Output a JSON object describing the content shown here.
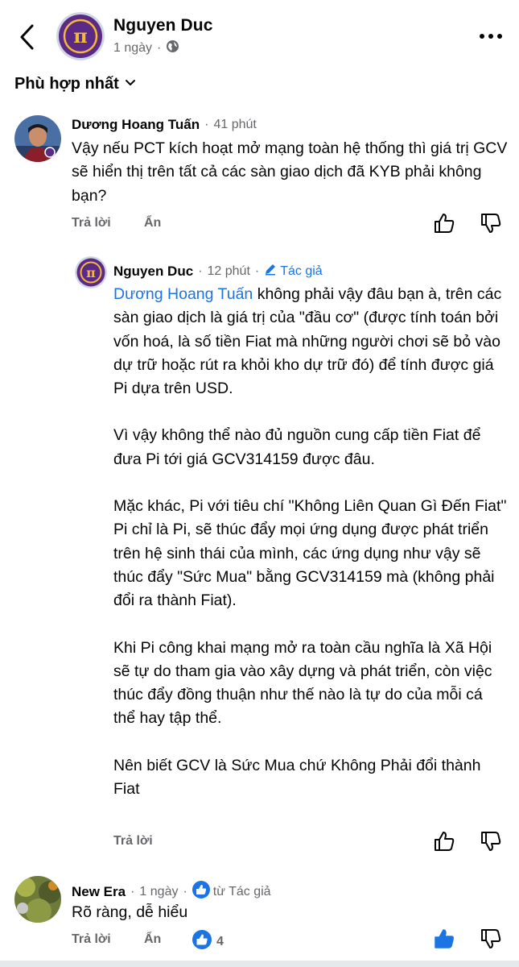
{
  "header": {
    "name": "Nguyen Duc",
    "time": "1 ngày",
    "separator": "·"
  },
  "sort": {
    "label": "Phù hợp nhất"
  },
  "comments": [
    {
      "author": "Dương Hoang Tuấn",
      "time": "41 phút",
      "text": "Vậy nếu PCT kích hoạt mở mạng toàn hệ thống thì giá trị GCV sẽ hiển thị trên tất cả các sàn giao dịch đã KYB phải không bạn?",
      "reply_label": "Trả lời",
      "hide_label": "Ẩn"
    },
    {
      "author": "Nguyen Duc",
      "time": "12 phút",
      "author_tag": "Tác giả",
      "mention": "Dương Hoang Tuấn",
      "paragraphs": [
        " không phải vậy đâu bạn à, trên các sàn giao dịch là giá trị của \"đầu cơ\" (được tính toán bởi vốn hoá, là số tiền Fiat mà những người chơi sẽ bỏ vào dự trữ hoặc rút ra khỏi kho dự trữ đó) để tính được giá Pi dựa trên USD.",
        "Vì vậy không thể nào đủ nguồn cung cấp tiền Fiat để đưa Pi tới giá GCV314159 được đâu.",
        "Mặc khác, Pi với tiêu chí \"Không Liên Quan Gì Đến Fiat\" Pi chỉ là Pi, sẽ thúc đẩy mọi ứng dụng được phát triển trên hệ sinh thái của mình, các ứng dụng như vậy sẽ thúc đẩy \"Sức Mua\" bằng GCV314159 mà (không phải đổi ra thành Fiat).",
        "Khi Pi công khai mạng mở ra toàn cầu nghĩa là Xã Hội sẽ tự do tham gia vào xây dựng và phát triển, còn việc thúc đẩy đồng thuận như thế nào là tự do của mỗi cá thể hay tập thể.",
        "Nên biết GCV là Sức Mua chứ Không Phải đổi thành Fiat"
      ],
      "reply_label": "Trả lời"
    },
    {
      "author": "New Era",
      "time": "1 ngày",
      "liked_by": "từ Tác giả",
      "text": "Rõ ràng, dễ hiểu",
      "reply_label": "Trả lời",
      "hide_label": "Ẩn",
      "like_count": "4"
    }
  ],
  "colors": {
    "link": "#1b74e4",
    "secondary_text": "#65676b",
    "pi_purple": "#5b2a86",
    "pi_gold": "#f2b93b"
  },
  "icons": [
    "back-arrow-icon",
    "globe-icon",
    "more-icon",
    "chevron-down-icon",
    "like-icon",
    "dislike-icon",
    "pencil-icon",
    "like-badge-icon"
  ]
}
